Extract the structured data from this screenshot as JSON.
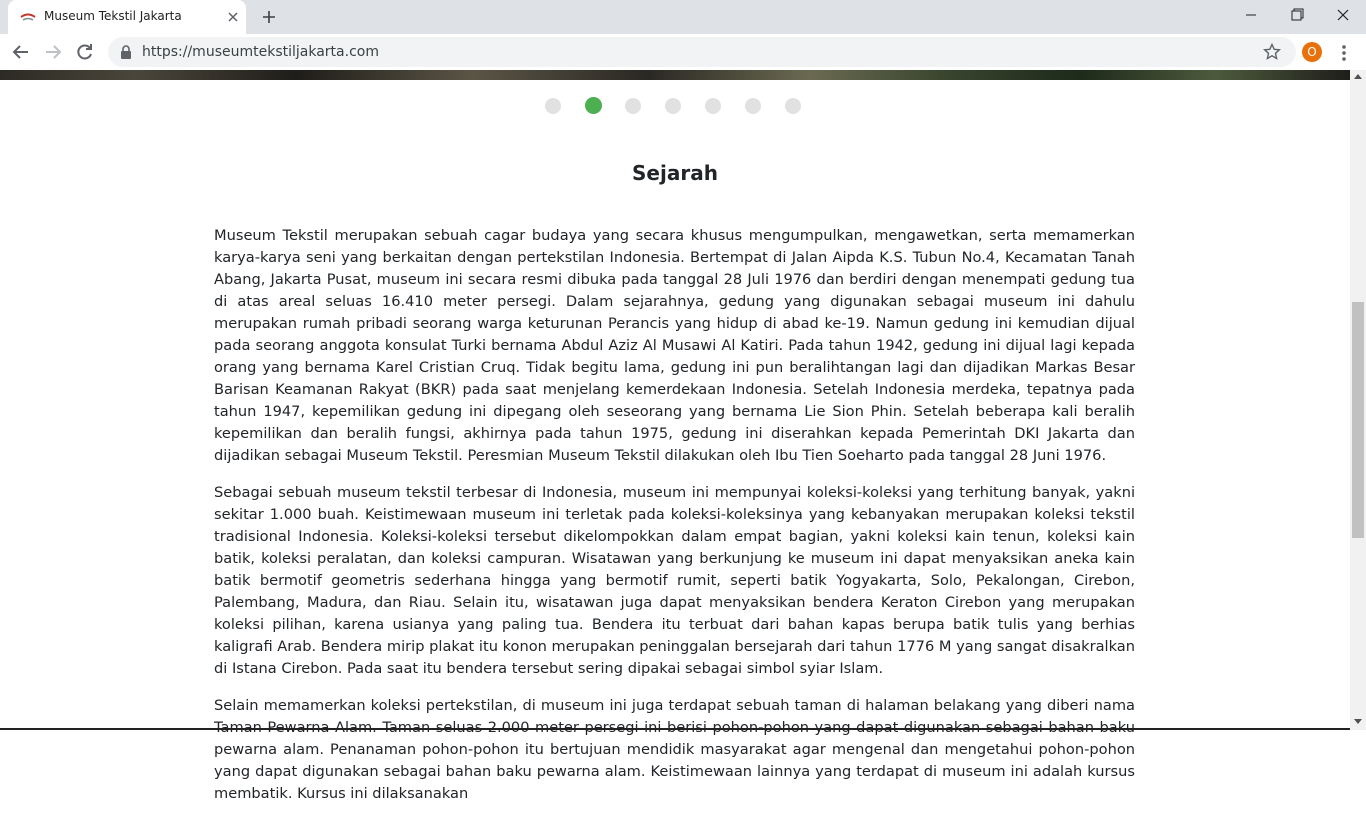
{
  "browser": {
    "tab_title": "Museum Tekstil Jakarta",
    "url": "https://museumtekstiljakarta.com",
    "profile_initial": "O"
  },
  "carousel": {
    "total_slides": 7,
    "active_slide": 2,
    "active_color": "#4caf50",
    "inactive_color": "#e1e1e1"
  },
  "section": {
    "title": "Sejarah",
    "paragraphs": [
      "Museum Tekstil merupakan sebuah cagar budaya yang secara khusus mengumpulkan, mengawetkan, serta memamerkan karya-karya seni yang berkaitan dengan pertekstilan Indonesia. Bertempat di Jalan Aipda K.S. Tubun No.4, Kecamatan Tanah Abang, Jakarta Pusat, museum ini secara resmi dibuka pada tanggal 28 Juli 1976 dan berdiri dengan menempati gedung tua di atas areal seluas 16.410 meter persegi. Dalam sejarahnya, gedung yang digunakan sebagai museum ini dahulu merupakan rumah pribadi seorang warga keturunan Perancis yang hidup di abad ke-19. Namun gedung ini kemudian dijual pada seorang anggota konsulat Turki bernama Abdul Aziz Al Musawi Al Katiri. Pada tahun 1942, gedung ini dijual lagi kepada orang yang bernama Karel Cristian Cruq. Tidak begitu lama, gedung ini pun beralihtangan lagi dan dijadikan Markas Besar Barisan Keamanan Rakyat (BKR) pada saat menjelang kemerdekaan Indonesia. Setelah Indonesia merdeka, tepatnya pada tahun 1947, kepemilikan gedung ini dipegang oleh seseorang yang bernama Lie Sion Phin. Setelah beberapa kali beralih kepemilikan dan beralih fungsi, akhirnya pada tahun 1975, gedung ini diserahkan kepada Pemerintah DKI Jakarta dan dijadikan sebagai Museum Tekstil. Peresmian Museum Tekstil dilakukan oleh Ibu Tien Soeharto pada tanggal 28 Juni 1976.",
      "Sebagai sebuah museum tekstil terbesar di Indonesia, museum ini mempunyai koleksi-koleksi yang terhitung banyak, yakni sekitar 1.000 buah. Keistimewaan museum ini terletak pada koleksi-koleksinya yang kebanyakan merupakan koleksi tekstil tradisional Indonesia. Koleksi-koleksi tersebut dikelompokkan dalam empat bagian, yakni koleksi kain tenun, koleksi kain batik, koleksi peralatan, dan koleksi campuran. Wisatawan yang berkunjung ke museum ini dapat menyaksikan aneka kain batik bermotif geometris sederhana hingga yang bermotif rumit, seperti batik Yogyakarta, Solo, Pekalongan, Cirebon, Palembang, Madura, dan Riau. Selain itu, wisatawan juga dapat menyaksikan bendera Keraton Cirebon yang merupakan koleksi pilihan, karena usianya yang paling tua. Bendera itu terbuat dari bahan kapas berupa batik tulis yang berhias kaligrafi Arab. Bendera mirip plakat itu konon merupakan peninggalan bersejarah dari tahun 1776 M yang sangat disakralkan di Istana Cirebon. Pada saat itu bendera tersebut sering dipakai sebagai simbol syiar Islam.",
      "Selain memamerkan koleksi pertekstilan, di museum ini juga terdapat sebuah taman di halaman belakang yang diberi nama Taman Pewarna Alam. Taman seluas 2.000 meter persegi ini berisi pohon-pohon yang dapat digunakan sebagai bahan baku pewarna alam. Penanaman pohon-pohon itu bertujuan mendidik masyarakat agar mengenal dan mengetahui pohon-pohon yang dapat digunakan sebagai bahan baku pewarna alam. Keistimewaan lainnya yang terdapat di museum ini adalah kursus membatik. Kursus ini dilaksanakan"
    ]
  }
}
